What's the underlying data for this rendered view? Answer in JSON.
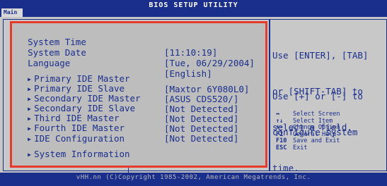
{
  "header": {
    "title": "BIOS SETUP UTILITY",
    "active_tab": "Main"
  },
  "settings": [
    {
      "label": "System Time",
      "value": "[11:10:19]",
      "submenu": false
    },
    {
      "label": "System Date",
      "value": "[Tue, 06/29/2004]",
      "submenu": false
    },
    {
      "label": "Language",
      "value": "[English]",
      "submenu": false
    },
    {
      "label": "Primary IDE Master",
      "value": "[Maxtor 6Y080L0]",
      "submenu": true
    },
    {
      "label": "Primary IDE Slave",
      "value": "[ASUS CDS520/]",
      "submenu": true
    },
    {
      "label": "Secondary IDE Master",
      "value": "[Not Detected]",
      "submenu": true
    },
    {
      "label": "Secondary IDE Slave",
      "value": "[Not Detected]",
      "submenu": true
    },
    {
      "label": "Third IDE Master",
      "value": "[Not Detected]",
      "submenu": true
    },
    {
      "label": "Fourth IDE Master",
      "value": "[Not Detected]",
      "submenu": true
    },
    {
      "label": "IDE Configuration",
      "value": "",
      "submenu": true
    },
    {
      "label": "System Information",
      "value": "",
      "submenu": true
    }
  ],
  "help": {
    "line1": "Use [ENTER], [TAB]",
    "line2": "or [SHIFT-TAB] to",
    "line3": "select a field.",
    "line4": "Use [+] or [-] to",
    "line5": "configure system",
    "line6": "time."
  },
  "keys": [
    {
      "key": "↔",
      "desc": "Select Screen"
    },
    {
      "key": "↑↓",
      "desc": "Select Item"
    },
    {
      "key": "+-",
      "desc": "Change Option"
    },
    {
      "key": "F1",
      "desc": "General Help"
    },
    {
      "key": "F10",
      "desc": "Save and Exit"
    },
    {
      "key": "ESC",
      "desc": "Exit"
    }
  ],
  "footer": {
    "text": "vHH.nn (C)Copyright 1985-2002, American Megatrends, Inc."
  }
}
